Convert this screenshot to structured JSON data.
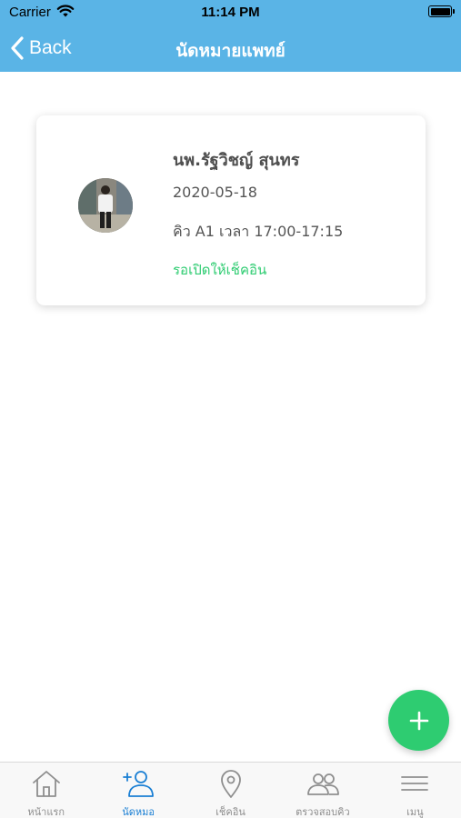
{
  "status_bar": {
    "carrier": "Carrier",
    "time": "11:14 PM",
    "wifi_icon": "wifi-icon",
    "battery_icon": "battery-icon"
  },
  "nav_bar": {
    "back_label": "Back",
    "back_icon": "chevron-left-icon",
    "title": "นัดหมายแพทย์",
    "background_color": "#5ab4e6"
  },
  "appointment": {
    "doctor_name": "นพ.รัฐวิชญ์ สุนทร",
    "date": "2020-05-18",
    "queue_time": "คิว A1 เวลา 17:00-17:15",
    "status": "รอเปิดให้เช็คอิน",
    "status_color": "#2ecc71",
    "avatar_icon": "doctor-photo"
  },
  "fab": {
    "icon": "plus-icon",
    "color": "#2ecc71"
  },
  "tab_bar": {
    "active_color": "#1a7fd4",
    "inactive_color": "#8e8e8e",
    "tabs": [
      {
        "label": "หน้าแรก",
        "icon": "home-icon",
        "active": false
      },
      {
        "label": "นัดหมอ",
        "icon": "add-user-icon",
        "active": true
      },
      {
        "label": "เช็คอิน",
        "icon": "location-pin-icon",
        "active": false
      },
      {
        "label": "ตรวจสอบคิว",
        "icon": "users-icon",
        "active": false
      },
      {
        "label": "เมนู",
        "icon": "menu-icon",
        "active": false
      }
    ]
  }
}
